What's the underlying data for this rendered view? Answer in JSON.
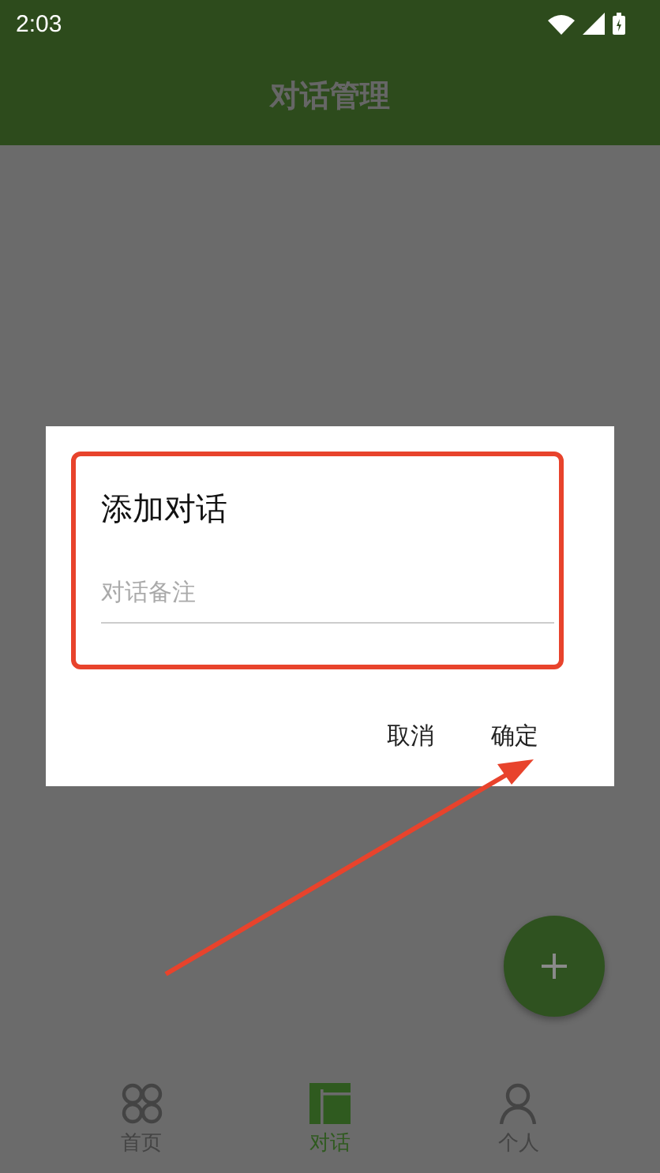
{
  "status_bar": {
    "time": "2:03"
  },
  "app_bar": {
    "title": "对话管理"
  },
  "dialog": {
    "title": "添加对话",
    "input": {
      "placeholder": "对话备注"
    },
    "buttons": [
      {
        "label": "取消"
      },
      {
        "label": "确定"
      }
    ]
  },
  "bottom_nav": [
    {
      "label": "首页",
      "selected": false
    },
    {
      "label": "对话",
      "selected": true
    },
    {
      "label": "个人",
      "selected": false
    }
  ]
}
